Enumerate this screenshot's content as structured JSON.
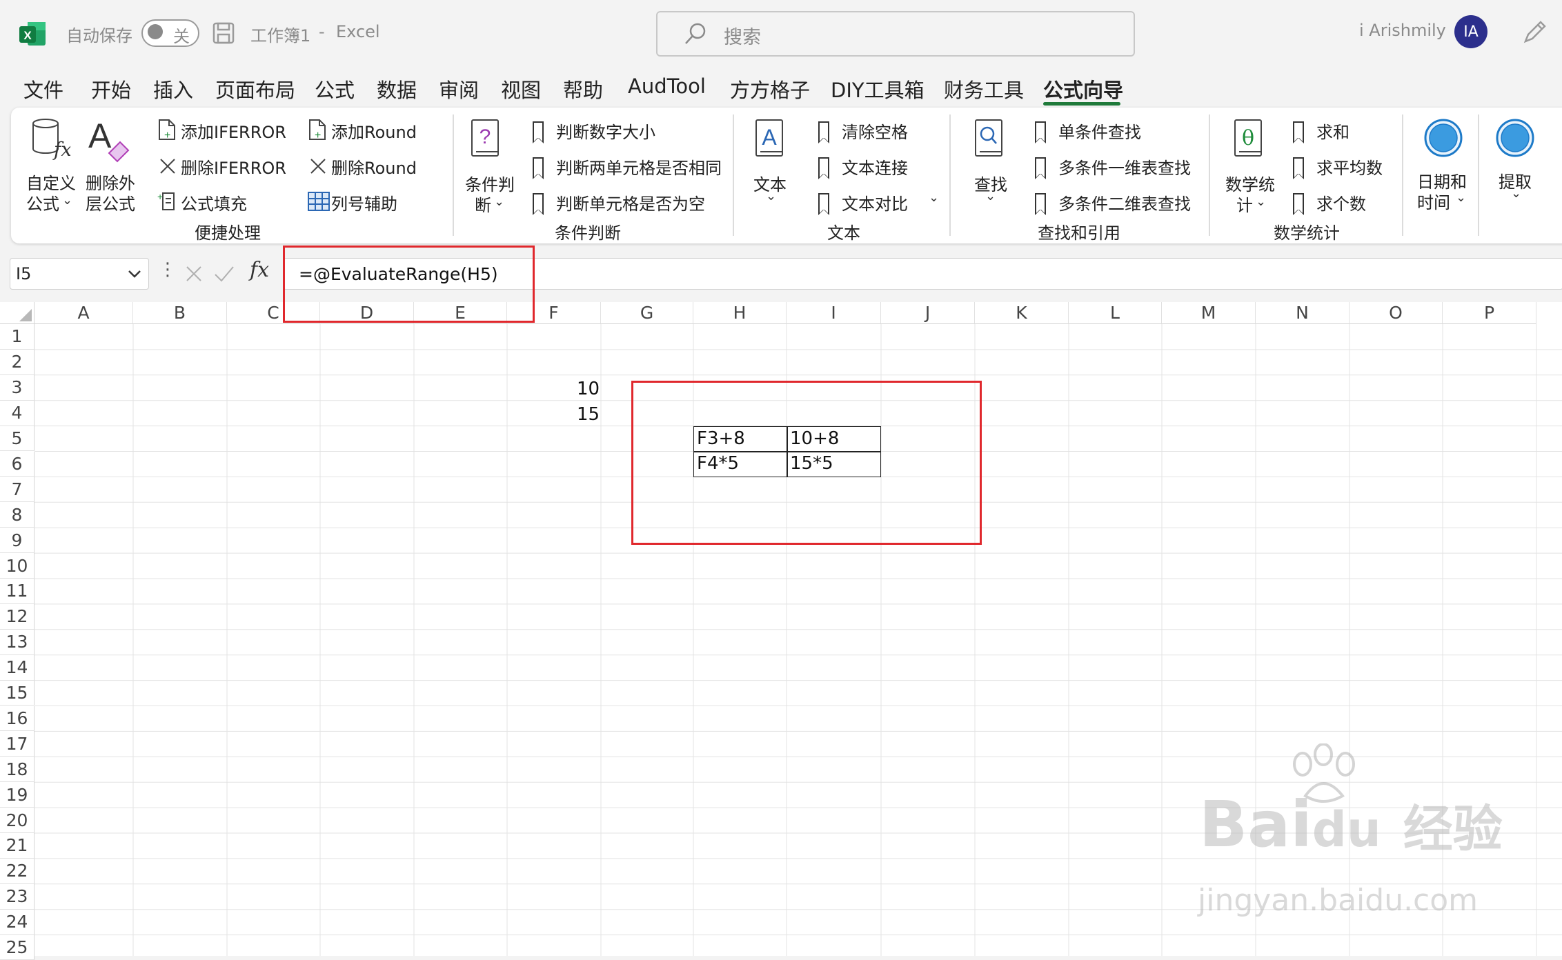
{
  "title_bar": {
    "autosave_label": "自动保存",
    "autosave_state": "关",
    "file_name": "工作簿1",
    "separator": "-",
    "app_name": "Excel",
    "search_placeholder": "搜索",
    "user_name": "i Arishmily",
    "avatar_initials": "IA"
  },
  "tabs": [
    {
      "label": "文件"
    },
    {
      "label": "开始"
    },
    {
      "label": "插入"
    },
    {
      "label": "页面布局"
    },
    {
      "label": "公式"
    },
    {
      "label": "数据"
    },
    {
      "label": "审阅"
    },
    {
      "label": "视图"
    },
    {
      "label": "帮助"
    },
    {
      "label": "AudTool"
    },
    {
      "label": "方方格子"
    },
    {
      "label": "DIY工具箱"
    },
    {
      "label": "财务工具"
    },
    {
      "label": "公式向导",
      "active": true
    }
  ],
  "ribbon": {
    "g1": {
      "custom_formula": [
        "自定义",
        "公式"
      ],
      "remove_outer": [
        "删除外",
        "层公式"
      ],
      "add_iferror": "添加IFERROR",
      "del_iferror": "删除IFERROR",
      "fill_formula": "公式填充",
      "add_round": "添加Round",
      "del_round": "删除Round",
      "col_helper": "列号辅助",
      "label": "便捷处理"
    },
    "g2": {
      "big_button": [
        "条件判",
        "断"
      ],
      "items": [
        "判断数字大小",
        "判断两单元格是否相同",
        "判断单元格是否为空"
      ],
      "label": "条件判断"
    },
    "g3": {
      "big_button": "文本",
      "items": [
        "清除空格",
        "文本连接",
        "文本对比"
      ],
      "label": "文本"
    },
    "g4": {
      "big_button": "查找",
      "items": [
        "单条件查找",
        "多条件一维表查找",
        "多条件二维表查找"
      ],
      "label": "查找和引用"
    },
    "g5": {
      "big_button": [
        "数学统",
        "计"
      ],
      "items": [
        "求和",
        "求平均数",
        "求个数"
      ],
      "label": "数学统计"
    },
    "g6": {
      "date_button": [
        "日期和",
        "时间"
      ],
      "extract_button": "提取"
    }
  },
  "formula_bar": {
    "name_box": "I5",
    "formula": "=@EvaluateRange(H5)"
  },
  "sheet": {
    "columns": [
      "A",
      "B",
      "C",
      "D",
      "E",
      "F",
      "G",
      "H",
      "I",
      "J",
      "K",
      "L",
      "M",
      "N",
      "O",
      "P"
    ],
    "rows": [
      "1",
      "2",
      "3",
      "4",
      "5",
      "6",
      "7",
      "8",
      "9",
      "10",
      "11",
      "12",
      "13",
      "14",
      "15",
      "16",
      "17",
      "18",
      "19",
      "20",
      "21",
      "22",
      "23",
      "24",
      "25"
    ],
    "cells": {
      "F3": "10",
      "F4": "15",
      "H5": "F3+8",
      "I5": "10+8",
      "H6": "F4*5",
      "I6": "15*5"
    }
  },
  "watermark": {
    "brand": "Bai",
    "brand2": "du",
    "cn": "经验",
    "url": "jingyan.baidu.com"
  },
  "colors": {
    "excel_green": "#1f7a3a",
    "highlight_red": "#e0282d",
    "avatar_bg": "#2c2f8c"
  }
}
